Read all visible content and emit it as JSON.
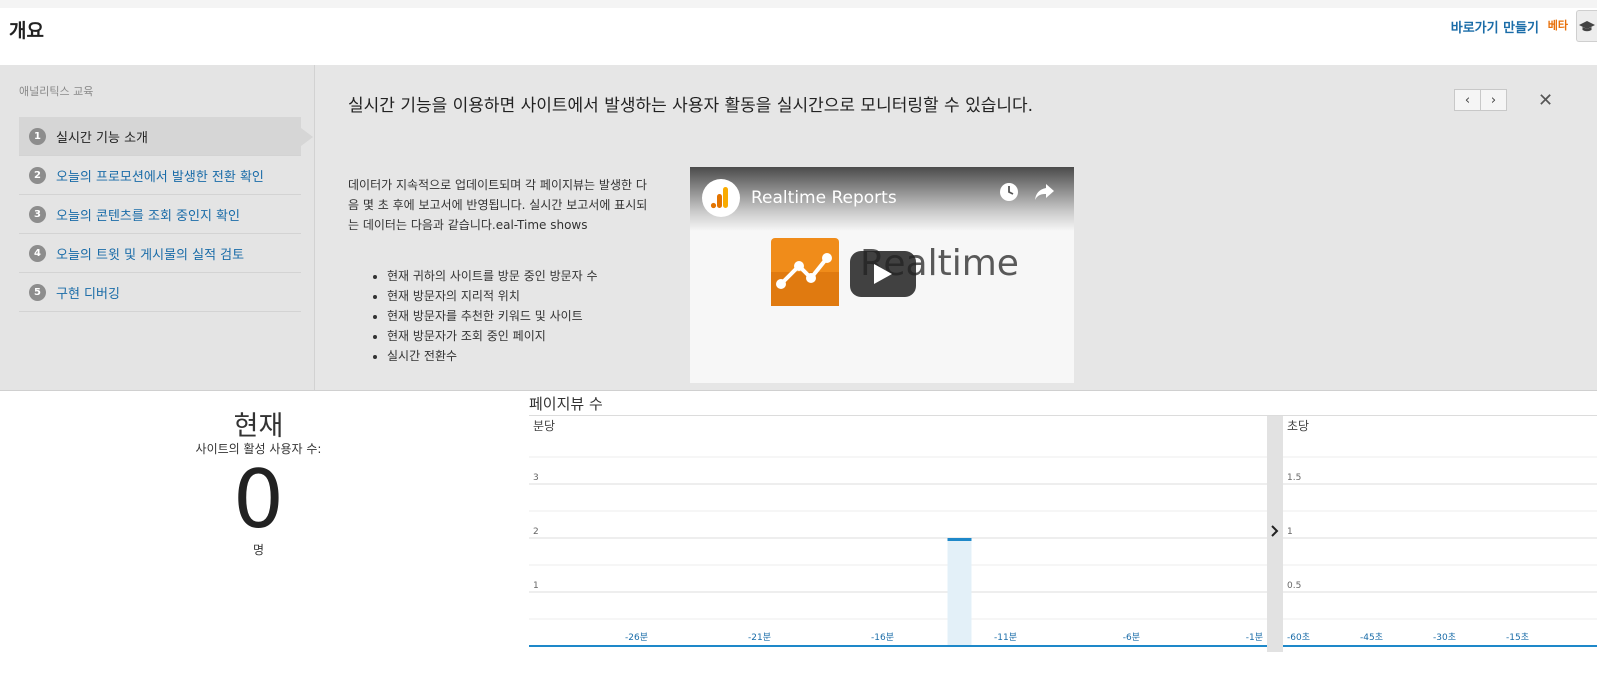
{
  "header": {
    "title": "개요",
    "shortcut_label": "바로가기 만들기",
    "beta_label": "베타"
  },
  "education": {
    "sidebar_title": "애널리틱스 교육",
    "steps": [
      {
        "num": "1",
        "label": "실시간 기능 소개",
        "active": true
      },
      {
        "num": "2",
        "label": "오늘의 프로모션에서 발생한 전환 확인",
        "active": false
      },
      {
        "num": "3",
        "label": "오늘의 콘텐츠를 조회 중인지 확인",
        "active": false
      },
      {
        "num": "4",
        "label": "오늘의 트윗 및 게시물의 실적 검토",
        "active": false
      },
      {
        "num": "5",
        "label": "구현 디버깅",
        "active": false
      }
    ],
    "heading": "실시간 기능을 이용하면 사이트에서 발생하는 사용자 활동을 실시간으로 모니터링할 수 있습니다.",
    "description": "데이터가 지속적으로 업데이트되며 각 페이지뷰는 발생한 다음 몇 초 후에 보고서에 반영됩니다. 실시간 보고서에 표시되는 데이터는 다음과 같습니다.eal-Time shows",
    "bullets": [
      "현재 귀하의 사이트를 방문 중인 방문자 수",
      "현재 방문자의 지리적 위치",
      "현재 방문자를 추천한 키워드 및 사이트",
      "현재 방문자가 조회 중인 페이지",
      "실시간 전환수"
    ],
    "video": {
      "title": "Realtime Reports",
      "overlay_text": "Realtime"
    }
  },
  "now": {
    "title": "현재",
    "subtitle": "사이트의 활성 사용자 수:",
    "count": "0",
    "unit": "명"
  },
  "pageviews": {
    "title": "페이지뷰 수"
  },
  "chart_data": [
    {
      "type": "bar",
      "title": "분당",
      "x_ticks": [
        "-26분",
        "-21분",
        "-16분",
        "-11분",
        "-6분",
        "-1분"
      ],
      "y_ticks": [
        "1",
        "2",
        "3"
      ],
      "ylim": [
        0,
        4
      ],
      "series": [
        {
          "values": [
            0,
            0,
            0,
            0,
            0,
            0,
            0,
            0,
            0,
            0,
            0,
            0,
            0,
            0,
            0,
            0,
            0,
            2,
            0,
            0,
            0,
            0,
            0,
            0,
            0,
            0,
            0,
            0,
            0,
            0
          ]
        }
      ],
      "highlight_color": "#1e88c9",
      "grid": true
    },
    {
      "type": "bar",
      "title": "초당",
      "x_ticks": [
        "-60초",
        "-45초",
        "-30초",
        "-15초"
      ],
      "y_ticks": [
        "0.5",
        "1",
        "1.5"
      ],
      "ylim": [
        0,
        2
      ],
      "series": [
        {
          "values": []
        }
      ],
      "grid": true
    }
  ]
}
